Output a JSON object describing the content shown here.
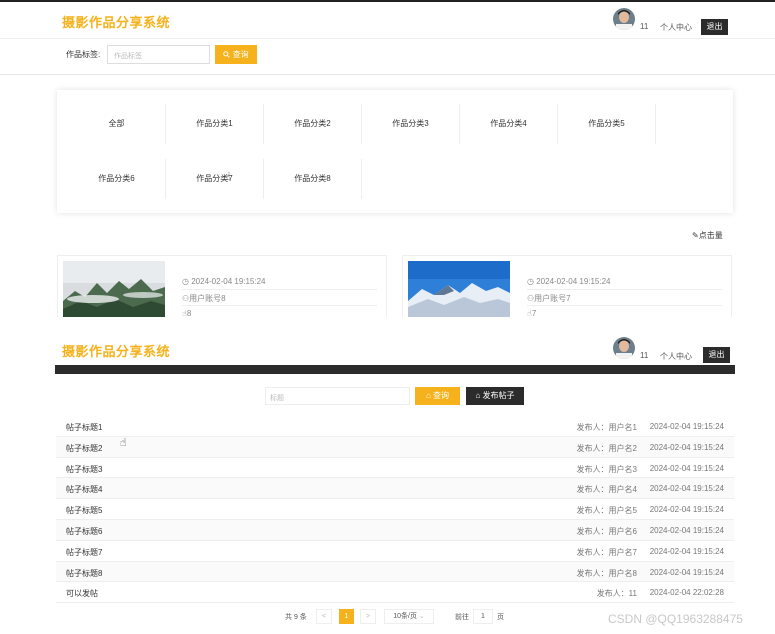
{
  "top_page": {
    "site_title": "摄影作品分享系统",
    "user": {
      "name": "11",
      "center_label": "个人中心",
      "logout_label": "退出"
    },
    "search": {
      "label": "作品标签:",
      "placeholder": "作品标签",
      "button_label": "查询",
      "button_icon": "search-icon"
    },
    "categories": [
      "全部",
      "作品分类1",
      "作品分类2",
      "作品分类3",
      "作品分类4",
      "作品分类5",
      "作品分类6",
      "作品分类7",
      "作品分类8"
    ],
    "click_rank_label": "点击量",
    "cards": [
      {
        "time": "2024-02-04 19:15:24",
        "author": "用户账号8",
        "likes": "8",
        "image": "misty-mountain-photo"
      },
      {
        "time": "2024-02-04 19:15:24",
        "author": "用户账号7",
        "likes": "7",
        "image": "snow-mountain-photo"
      }
    ]
  },
  "bottom_page": {
    "site_title": "摄影作品分享系统",
    "user": {
      "name": "11",
      "center_label": "个人中心",
      "logout_label": "退出"
    },
    "search": {
      "placeholder": "标题",
      "button_label": "查询",
      "post_button_label": "发布帖子"
    },
    "posts": [
      {
        "title": "帖子标题1",
        "publisher": "发布人：用户名1",
        "time": "2024-02-04 19:15:24"
      },
      {
        "title": "帖子标题2",
        "publisher": "发布人：用户名2",
        "time": "2024-02-04 19:15:24"
      },
      {
        "title": "帖子标题3",
        "publisher": "发布人：用户名3",
        "time": "2024-02-04 19:15:24"
      },
      {
        "title": "帖子标题4",
        "publisher": "发布人：用户名4",
        "time": "2024-02-04 19:15:24"
      },
      {
        "title": "帖子标题5",
        "publisher": "发布人：用户名5",
        "time": "2024-02-04 19:15:24"
      },
      {
        "title": "帖子标题6",
        "publisher": "发布人：用户名6",
        "time": "2024-02-04 19:15:24"
      },
      {
        "title": "帖子标题7",
        "publisher": "发布人：用户名7",
        "time": "2024-02-04 19:15:24"
      },
      {
        "title": "帖子标题8",
        "publisher": "发布人：用户名8",
        "time": "2024-02-04 19:15:24"
      },
      {
        "title": "可以发帖",
        "publisher": "发布人：11",
        "time": "2024-02-04 22:02:28"
      }
    ],
    "pagination": {
      "total": "共 9 条",
      "prev": "<",
      "current_page": "1",
      "next": ">",
      "page_size": "10条/页",
      "goto_label": "前往",
      "goto_value": "1",
      "page_unit": "页"
    }
  },
  "watermark": "CSDN @QQ1963288475",
  "colors": {
    "accent": "#f5b21c",
    "dark": "#2b2b2b"
  }
}
